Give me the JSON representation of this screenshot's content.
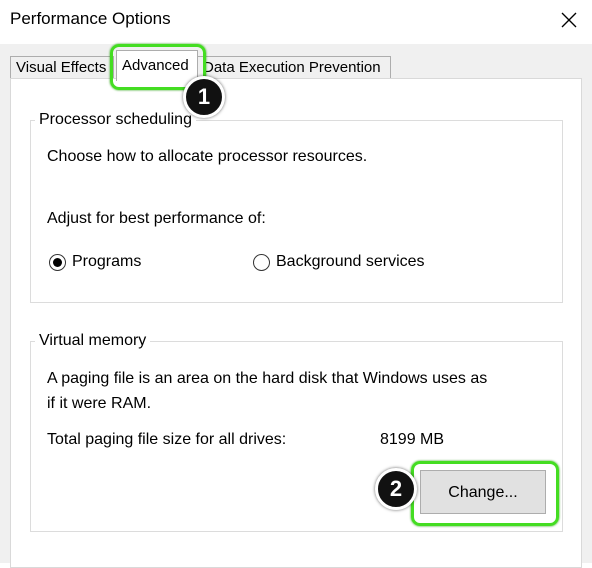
{
  "window": {
    "title": "Performance Options"
  },
  "tabs": [
    {
      "label": "Visual Effects"
    },
    {
      "label": "Advanced"
    },
    {
      "label": "Data Execution Prevention"
    }
  ],
  "processor": {
    "heading": "Processor scheduling",
    "description": "Choose how to allocate processor resources.",
    "adjust_label": "Adjust for best performance of:",
    "options": [
      {
        "label": "Programs",
        "selected": true
      },
      {
        "label": "Background services",
        "selected": false
      }
    ]
  },
  "virtual_memory": {
    "heading": "Virtual memory",
    "description_line1": "A paging file is an area on the hard disk that Windows uses as",
    "description_line2": "if it were RAM.",
    "total_label": "Total paging file size for all drives:",
    "total_value": "8199 MB",
    "change_button": "Change..."
  },
  "annotations": {
    "badge1": "1",
    "badge2": "2",
    "highlight_color": "#44dd22"
  }
}
